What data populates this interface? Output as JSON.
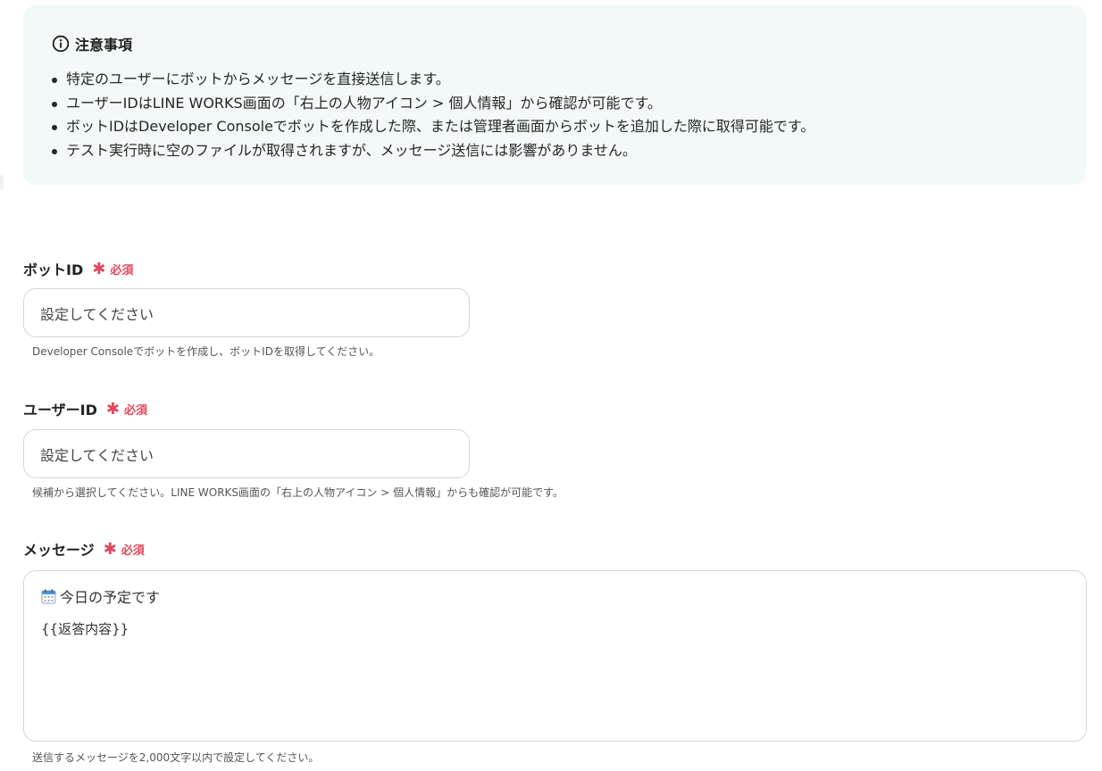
{
  "notice": {
    "title": "注意事項",
    "items": [
      "特定のユーザーにボットからメッセージを直接送信します。",
      "ユーザーIDはLINE WORKS画面の「右上の人物アイコン > 個人情報」から確認が可能です。",
      "ボットIDはDeveloper Consoleでボットを作成した際、または管理者画面からボットを追加した際に取得可能です。",
      "テスト実行時に空のファイルが取得されますが、メッセージ送信には影響がありません。"
    ]
  },
  "fields": {
    "bot_id": {
      "label": "ボットID",
      "required_text": "必須",
      "placeholder": "設定してください",
      "help": "Developer Consoleでボットを作成し、ボットIDを取得してください。"
    },
    "user_id": {
      "label": "ユーザーID",
      "required_text": "必須",
      "placeholder": "設定してください",
      "help": "候補から選択してください。LINE WORKS画面の「右上の人物アイコン > 個人情報」からも確認が可能です。"
    },
    "message": {
      "label": "メッセージ",
      "required_text": "必須",
      "line1": "今日の予定です",
      "line2": "{{返答内容}}",
      "help": "送信するメッセージを2,000文字以内で設定してください。"
    }
  },
  "colors": {
    "required": "#e5475b",
    "notice_bg": "#f3f8f9",
    "border": "#d2d6da"
  },
  "icons": {
    "notice": "info-circle-icon",
    "required": "asterisk-icon",
    "message_prefix": "calendar-icon"
  }
}
